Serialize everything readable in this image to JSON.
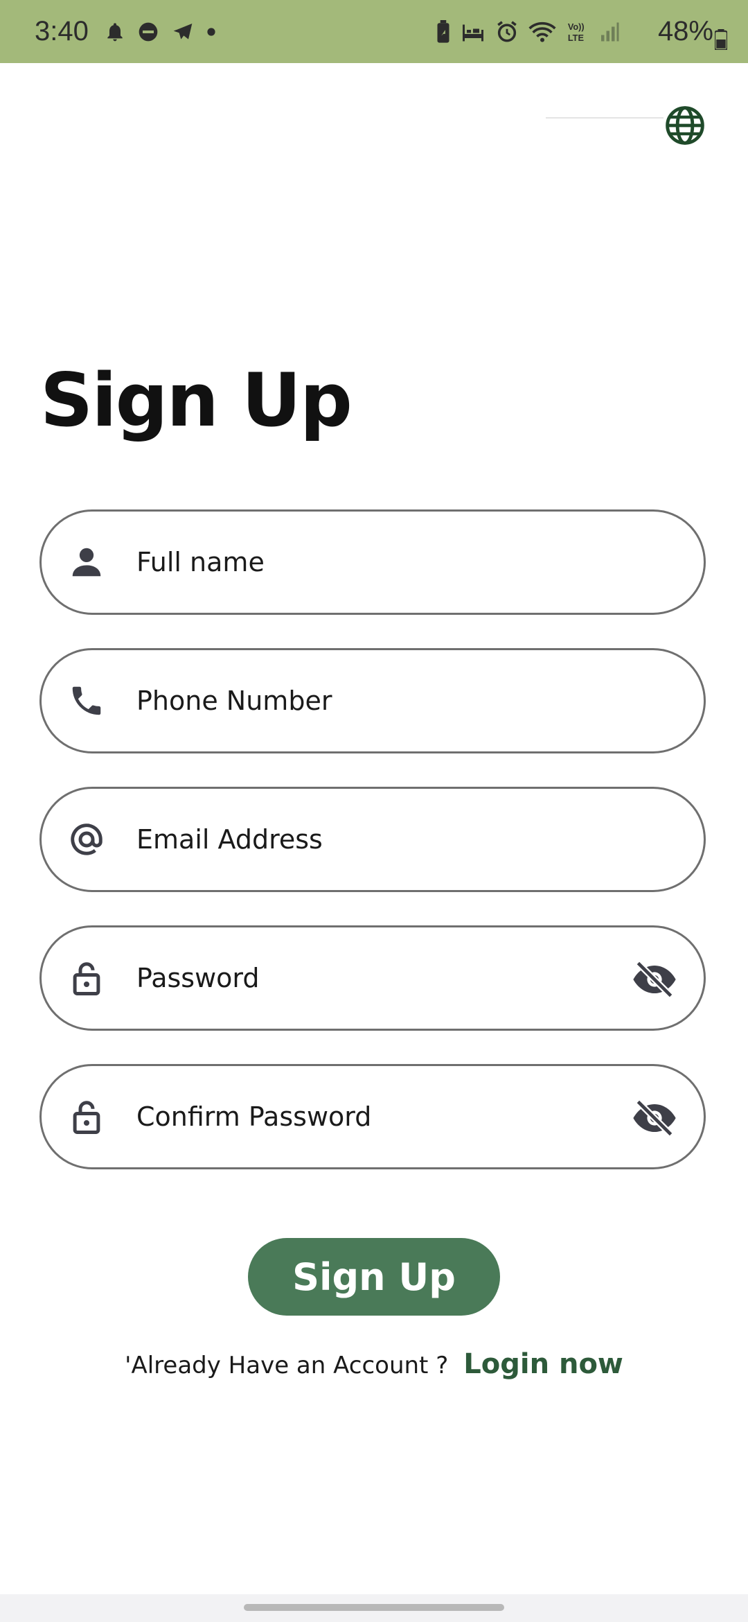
{
  "status_bar": {
    "time": "3:40",
    "battery": "48%",
    "left_icons": [
      "bell-icon",
      "do-not-disturb-icon",
      "telegram-icon",
      "dot-icon"
    ],
    "right_icons": [
      "battery-saver-icon",
      "sleep-icon",
      "alarm-icon",
      "wifi-icon",
      "volte-icon",
      "signal-icon"
    ],
    "background": "#a3b97a"
  },
  "language": {
    "icon": "globe-icon",
    "color": "#1f4a2a"
  },
  "title": "Sign Up",
  "fields": {
    "full_name": {
      "placeholder": "Full name",
      "icon": "person-icon",
      "value": ""
    },
    "phone": {
      "placeholder": "Phone Number",
      "icon": "phone-icon",
      "value": ""
    },
    "email": {
      "placeholder": "Email Address",
      "icon": "at-icon",
      "value": ""
    },
    "password": {
      "placeholder": "Password",
      "icon": "lock-icon",
      "toggle_icon": "eye-off-icon",
      "value": ""
    },
    "confirm_password": {
      "placeholder": "Confirm Password",
      "icon": "lock-icon",
      "toggle_icon": "eye-off-icon",
      "value": ""
    }
  },
  "signup_button": {
    "label": "Sign Up",
    "color": "#4a7a58"
  },
  "login": {
    "question": "'Already Have an Account ?",
    "link": "Login now",
    "link_color": "#2d5a3a"
  }
}
